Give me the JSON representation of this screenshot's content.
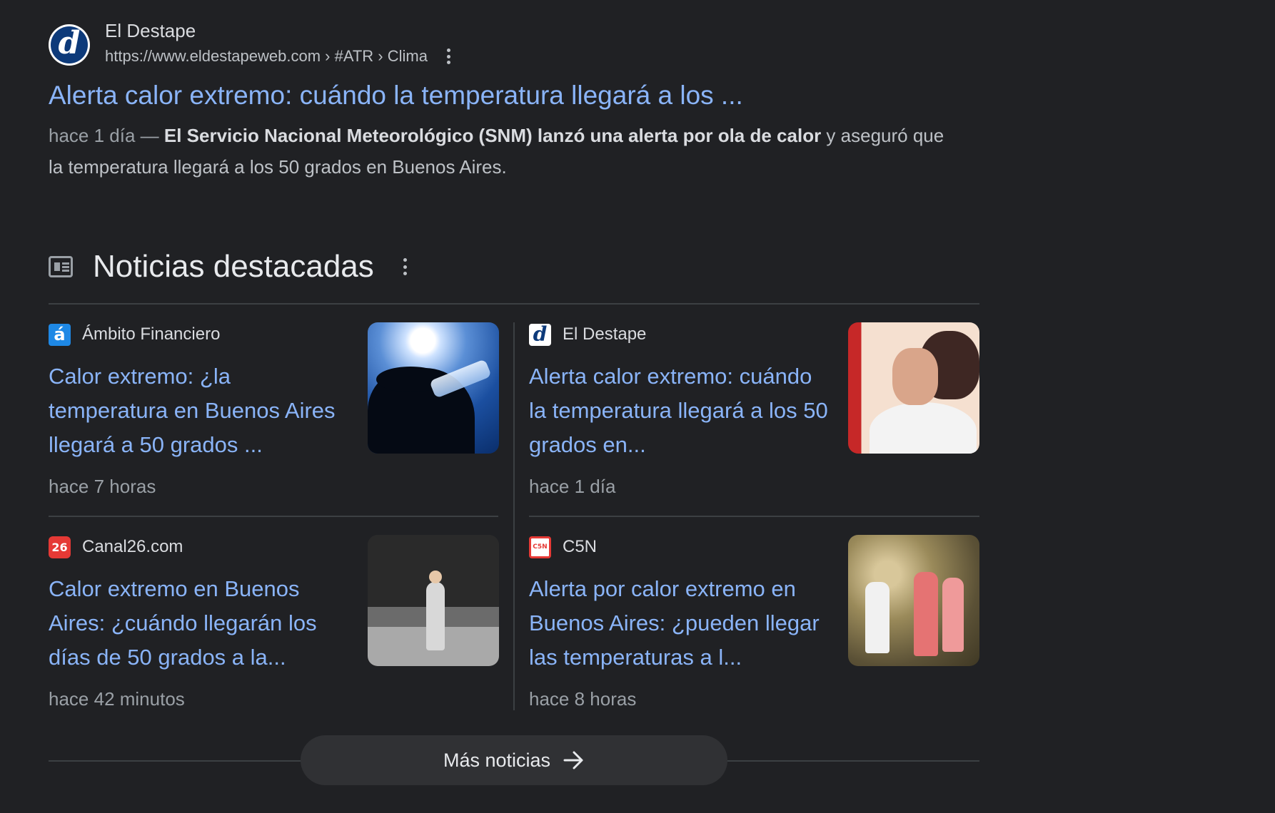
{
  "result": {
    "site_name": "El Destape",
    "logo_letter": "d",
    "url": "https://www.eldestapeweb.com › #ATR › Clima",
    "title": "Alerta calor extremo: cuándo la temperatura llegará a los ...",
    "snippet_date": "hace 1 día — ",
    "snippet_bold": "El Servicio Nacional Meteorológico (SNM) lanzó una alerta por ola de calor",
    "snippet_rest": " y aseguró que la temperatura llegará a los 50 grados en Buenos Aires."
  },
  "news": {
    "heading": "Noticias destacadas",
    "cards": [
      {
        "source": "Ámbito Financiero",
        "favicon_text": "á",
        "title": "Calor extremo: ¿la temperatura en Buenos Aires llegará a 50 grados ...",
        "time": "hace 7 horas",
        "thumbnail_icon": "person-drinking-water-in-sun-image"
      },
      {
        "source": "El Destape",
        "favicon_text": "d",
        "title": "Alerta calor extremo: cuándo la temperatura llegará a los 50 grados en...",
        "time": "hace 1 día",
        "thumbnail_icon": "woman-covering-face-heat-image"
      },
      {
        "source": "Canal26.com",
        "favicon_text": "26",
        "title": "Calor extremo en Buenos Aires: ¿cuándo llegarán los días de 50 grados a la...",
        "time": "hace 42 minutos",
        "thumbnail_icon": "person-walking-street-image"
      },
      {
        "source": "C5N",
        "favicon_text": "C5N",
        "title": "Alerta por calor extremo en Buenos Aires: ¿pueden llegar las temperaturas a l...",
        "time": "hace 8 horas",
        "thumbnail_icon": "people-near-fountain-image"
      }
    ],
    "more_label": "Más noticias"
  },
  "colors": {
    "background": "#202124",
    "link": "#8ab4f8",
    "text": "#e8eaed",
    "secondary_text": "#9aa0a6",
    "divider": "#3c4043"
  }
}
